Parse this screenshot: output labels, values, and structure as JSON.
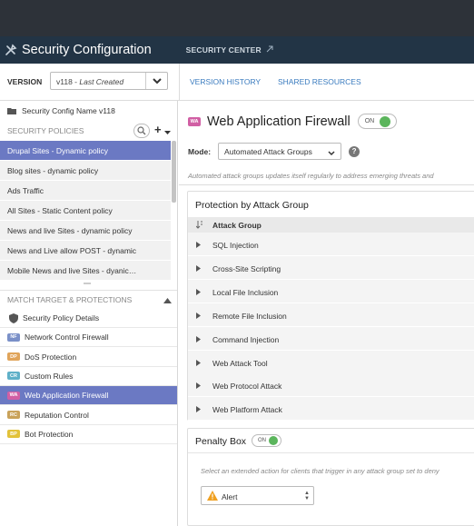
{
  "header": {
    "title": "Security Configuration",
    "section": "SECURITY CENTER",
    "section_icon": "external-link-icon"
  },
  "version_bar": {
    "label": "VERSION",
    "version_number": "v118",
    "version_separator": " - ",
    "version_status": "Last Created",
    "links": [
      "VERSION HISTORY",
      "SHARED RESOURCES"
    ]
  },
  "sidebar": {
    "config_name": "Security Config Name v118",
    "policies_header": "SECURITY POLICIES",
    "policies": [
      {
        "label": "Drupal Sites - Dynamic policy",
        "active": true
      },
      {
        "label": "Blog sites - dynamic policy",
        "active": false
      },
      {
        "label": "Ads Traffic",
        "active": false
      },
      {
        "label": "All Sites - Static Content policy",
        "active": false
      },
      {
        "label": "News and live Sites - dynamic policy",
        "active": false
      },
      {
        "label": "News and Live allow POST - dynamic",
        "active": false
      },
      {
        "label": "Mobile News and live Sites - dyanic…",
        "active": false
      }
    ],
    "match_header": "MATCH TARGET & PROTECTIONS",
    "protections": [
      {
        "badge": "",
        "icon": "shield-icon",
        "label": "Security Policy Details",
        "active": false
      },
      {
        "badge": "NF",
        "badge_color": "#7a90c8",
        "label": "Network Control Firewall",
        "active": false
      },
      {
        "badge": "DP",
        "badge_color": "#e0a45a",
        "label": "DoS Protection",
        "active": false
      },
      {
        "badge": "CR",
        "badge_color": "#5fb0c8",
        "label": "Custom Rules",
        "active": false
      },
      {
        "badge": "WA",
        "badge_color": "#d15fa4",
        "label": "Web Application Firewall",
        "active": true
      },
      {
        "badge": "RC",
        "badge_color": "#c9a25a",
        "label": "Reputation Control",
        "active": false
      },
      {
        "badge": "BP",
        "badge_color": "#e2c23a",
        "label": "Bot Protection",
        "active": false
      }
    ]
  },
  "main": {
    "badge": "WA",
    "title": "Web Application Firewall",
    "toggle_label": "ON",
    "mode_label": "Mode:",
    "mode_value": "Automated Attack Groups",
    "description": "Automated attack groups updates itself regularly to address emerging threats and",
    "attack_panel_title": "Protection by Attack Group",
    "attack_column": "Attack Group",
    "attack_groups": [
      "SQL Injection",
      "Cross-Site Scripting",
      "Local File Inclusion",
      "Remote File Inclusion",
      "Command Injection",
      "Web Attack Tool",
      "Web Protocol Attack",
      "Web Platform Attack"
    ],
    "penalty_title": "Penalty Box",
    "penalty_toggle": "ON",
    "penalty_description": "Select an extended action for clients that trigger in any attack group set to deny",
    "penalty_action": "Alert"
  },
  "colors": {
    "topbar": "#2d3239",
    "header": "#223445",
    "active": "#6b79c3",
    "link": "#3a7bbf",
    "toggle_on": "#5bb55c"
  }
}
